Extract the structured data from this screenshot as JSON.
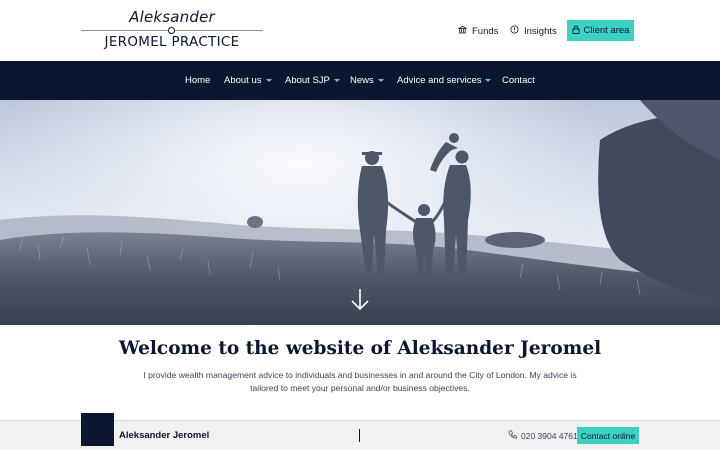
{
  "logo": {
    "script_text": "Aleksander",
    "caps_text": "JEROMEL PRACTICE"
  },
  "utility_nav": {
    "funds_label": "Funds",
    "funds_icon": "bank-icon",
    "insights_label": "Insights",
    "insights_icon": "lightbulb-icon",
    "client_area_label": "Client area",
    "client_area_icon": "lock-icon"
  },
  "main_nav": {
    "items": [
      {
        "label": "Home",
        "has_dropdown": false
      },
      {
        "label": "About us",
        "has_dropdown": true
      },
      {
        "label": "About SJP",
        "has_dropdown": true
      },
      {
        "label": "News",
        "has_dropdown": true
      },
      {
        "label": "Advice and services",
        "has_dropdown": true
      },
      {
        "label": "Contact",
        "has_dropdown": false
      }
    ]
  },
  "hero": {
    "scroll_icon": "arrow-down-icon"
  },
  "welcome": {
    "title": "Welcome to the website of Aleksander Jeromel",
    "text": "I provide wealth management advice to individuals and businesses in and around the City of London. My advice is tailored to meet your personal and/or business objectives."
  },
  "footer": {
    "name": "Aleksander Jeromel",
    "phone": "020 3904 4761",
    "phone_icon": "phone-icon",
    "contact_label": "Contact online"
  },
  "colors": {
    "navy": "#0b1730",
    "accent": "#3dd1c3",
    "footer_bg": "#f1f1f1"
  }
}
